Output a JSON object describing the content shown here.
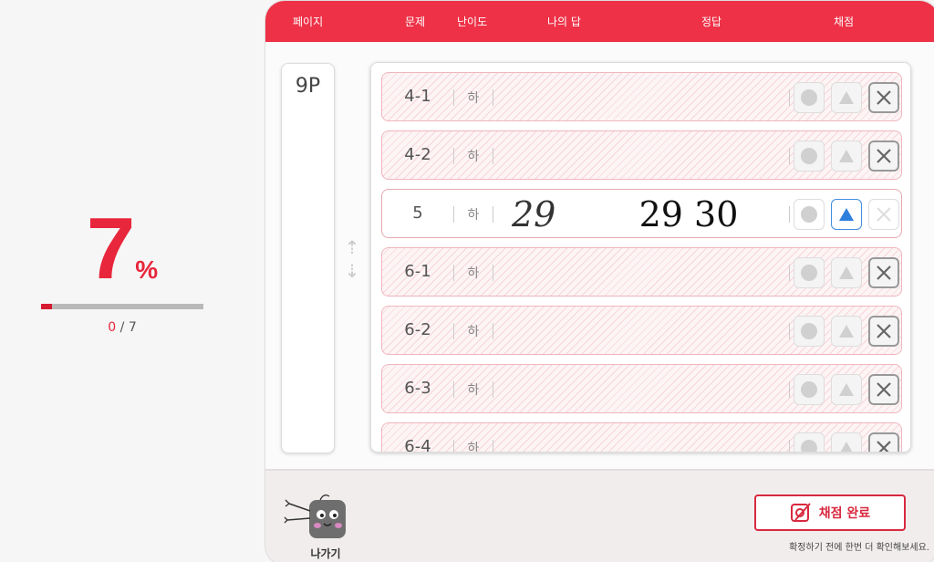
{
  "score": {
    "percent_value": "7",
    "percent_sign": "%",
    "progress_fraction": 0.07,
    "current": "0",
    "separator": " / ",
    "total": "7"
  },
  "header": {
    "page": "페이지",
    "question": "문제",
    "difficulty": "난이도",
    "my_answer": "나의 답",
    "correct_answer": "정답",
    "grading": "채점"
  },
  "page_label": "9P",
  "rows": [
    {
      "q": "4-1",
      "lvl": "하"
    },
    {
      "q": "4-2",
      "lvl": "하"
    },
    {
      "q": "5",
      "lvl": "하",
      "my_answer": "29",
      "correct_answer": "29 30"
    },
    {
      "q": "6-1",
      "lvl": "하"
    },
    {
      "q": "6-2",
      "lvl": "하"
    },
    {
      "q": "6-3",
      "lvl": "하"
    },
    {
      "q": "6-4",
      "lvl": "하"
    }
  ],
  "footer": {
    "exit_label": "나가기",
    "complete_label": "채점 완료",
    "hint": "확정하기 전에 한번 더 확인해보세요."
  },
  "colors": {
    "accent": "#ee3147",
    "active_mark": "#2d7fdd"
  },
  "icons": [
    "up-arrow-icon",
    "down-arrow-icon",
    "circle-mark-icon",
    "triangle-mark-icon",
    "x-mark-icon",
    "mascot-icon",
    "grading-pen-icon"
  ]
}
